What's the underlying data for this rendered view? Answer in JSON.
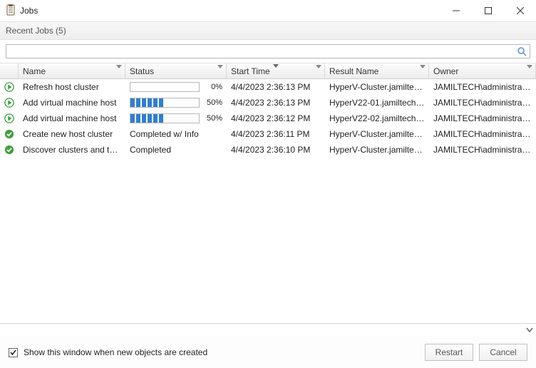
{
  "window": {
    "title": "Jobs"
  },
  "header": {
    "recent_jobs": "Recent Jobs (5)"
  },
  "columns": {
    "name": "Name",
    "status": "Status",
    "start_time": "Start Time",
    "result_name": "Result Name",
    "owner": "Owner"
  },
  "icons": {
    "running": "play-circle-icon",
    "completed": "check-circle-icon"
  },
  "jobs": [
    {
      "icon": "running",
      "name": "Refresh host cluster",
      "status_type": "progress",
      "percent": 0,
      "start_time": "4/4/2023 2:36:13 PM",
      "result_name": "HyperV-Cluster.jamiltec...",
      "owner": "JAMILTECH\\administrator"
    },
    {
      "icon": "running",
      "name": "Add virtual machine host",
      "status_type": "progress",
      "percent": 50,
      "start_time": "4/4/2023 2:36:13 PM",
      "result_name": "HyperV22-01.jamiltech.l...",
      "owner": "JAMILTECH\\administrator"
    },
    {
      "icon": "running",
      "name": "Add virtual machine host",
      "status_type": "progress",
      "percent": 50,
      "start_time": "4/4/2023 2:36:12 PM",
      "result_name": "HyperV22-02.jamiltech.l...",
      "owner": "JAMILTECH\\administrator"
    },
    {
      "icon": "completed",
      "name": "Create new host cluster",
      "status_type": "text",
      "status_text": "Completed w/ Info",
      "start_time": "4/4/2023 2:36:11 PM",
      "result_name": "HyperV-Cluster.jamiltec...",
      "owner": "JAMILTECH\\administrator"
    },
    {
      "icon": "completed",
      "name": "Discover clusters and th...",
      "status_type": "text",
      "status_text": "Completed",
      "start_time": "4/4/2023 2:36:10 PM",
      "result_name": "HyperV-Cluster.jamiltec...",
      "owner": "JAMILTECH\\administrator"
    }
  ],
  "footer": {
    "checkbox_label": "Show this window when new objects are created",
    "restart": "Restart",
    "cancel": "Cancel"
  }
}
